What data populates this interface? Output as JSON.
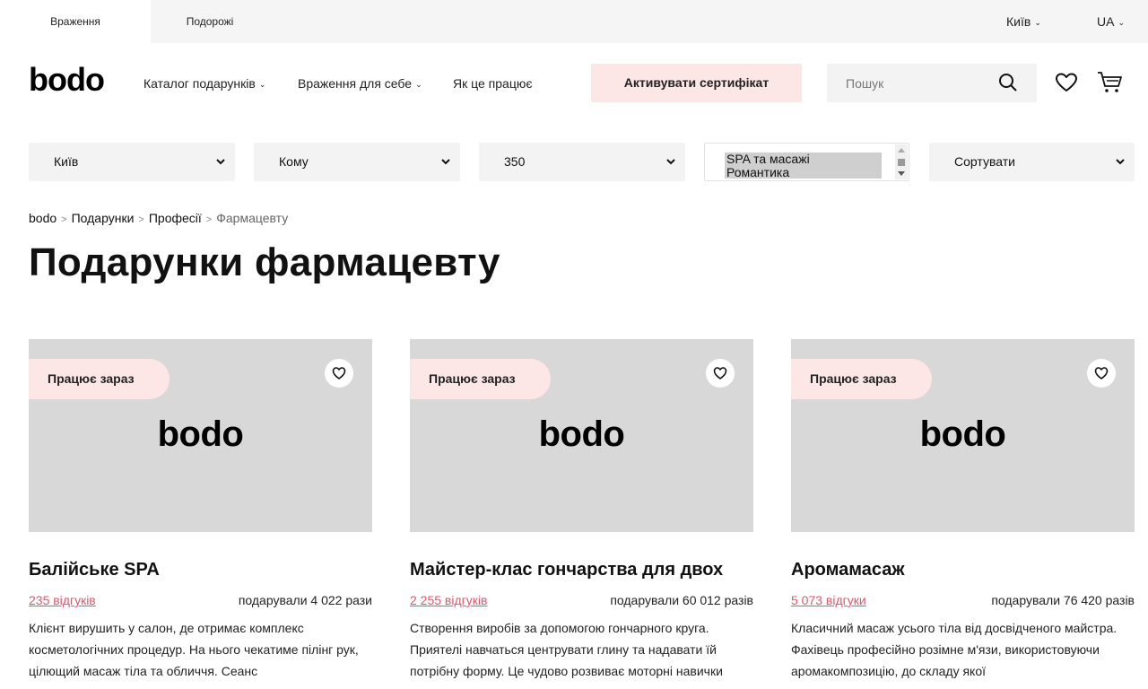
{
  "topbar": {
    "tabs": [
      "Враження",
      "Подорожі"
    ],
    "city": "Київ",
    "lang": "UA"
  },
  "header": {
    "logo": "bodo",
    "nav": [
      "Каталог подарунків",
      "Враження для себе",
      "Як це працює"
    ],
    "activate_label": "Активувати сертифікат",
    "search_placeholder": "Пошук"
  },
  "filters": {
    "city": "Київ",
    "whom": "Кому",
    "price": "350",
    "categories": [
      "SPA та масажі",
      "Романтика"
    ],
    "sort": "Сортувати"
  },
  "breadcrumb": [
    "bodo",
    "Подарунки",
    "Професії",
    "Фармацевту"
  ],
  "page_title": "Подарунки фармацевту",
  "cards": [
    {
      "badge": "Працює зараз",
      "logo": "bodo",
      "title": "Балійське SPA",
      "reviews": "235 відгуків",
      "gifted": "подарували 4 022 рази",
      "desc": "Клієнт вирушить у салон, де отримає комплекс косметологічних процедур. На нього чекатиме пілінг рук, цілющий масаж тіла та обличчя. Сеанс"
    },
    {
      "badge": "Працює зараз",
      "logo": "bodo",
      "title": "Майстер-клас гончарства для двох",
      "reviews": "2 255 відгуків",
      "gifted": "подарували 60 012 разів",
      "desc": "Створення виробів за допомогою гончарного круга. Приятелі навчаться центрувати глину та надавати їй потрібну форму. Це чудово розвиває моторні навички"
    },
    {
      "badge": "Працює зараз",
      "logo": "bodo",
      "title": "Аромамасаж",
      "reviews": "5 073 відгуки",
      "gifted": "подарували 76 420 разів",
      "desc": "Класичний масаж усього тіла від досвідченого майстра. Фахівець професійно розімне м'язи, використовуючи аромакомпозицію, до складу якої"
    }
  ]
}
